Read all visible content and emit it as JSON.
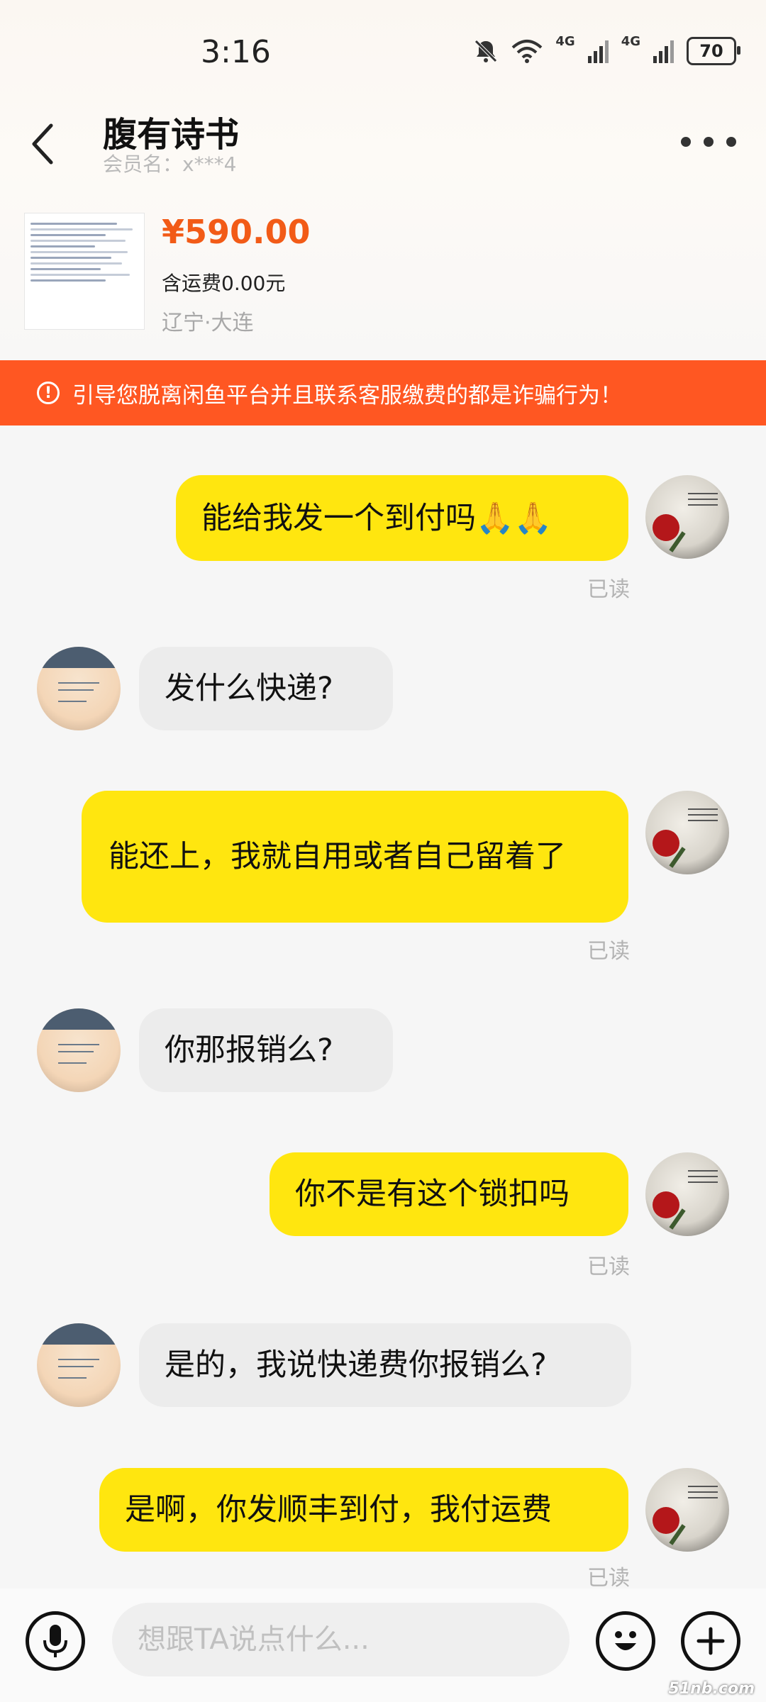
{
  "status_bar": {
    "time": "3:16",
    "battery": "70",
    "net1": "4G",
    "net2": "4G"
  },
  "header": {
    "title": "腹有诗书",
    "subtitle": "会员名：x***4"
  },
  "product": {
    "price": "¥590.00",
    "shipping": "含运费0.00元",
    "location": "辽宁·大连"
  },
  "warning": {
    "text": "引导您脱离闲鱼平台并且联系客服缴费的都是诈骗行为！"
  },
  "messages": [
    {
      "side": "me",
      "text": "能给我发一个到付吗🙏🙏",
      "status": "已读"
    },
    {
      "side": "them",
      "text": "发什么快递?"
    },
    {
      "side": "me",
      "text": "能还上，我就自用或者自己留着了",
      "status": "已读"
    },
    {
      "side": "them",
      "text": "你那报销么?"
    },
    {
      "side": "me",
      "text": "你不是有这个锁扣吗",
      "status": "已读"
    },
    {
      "side": "them",
      "text": "是的，我说快递费你报销么?"
    },
    {
      "side": "me",
      "text": "是啊，你发顺丰到付，我付运费",
      "status": "已读"
    }
  ],
  "input": {
    "placeholder": "想跟TA说点什么..."
  },
  "watermark": "51nb.com",
  "colors": {
    "accent": "#ffe60f",
    "warning": "#ff5722",
    "price": "#f25b17"
  }
}
